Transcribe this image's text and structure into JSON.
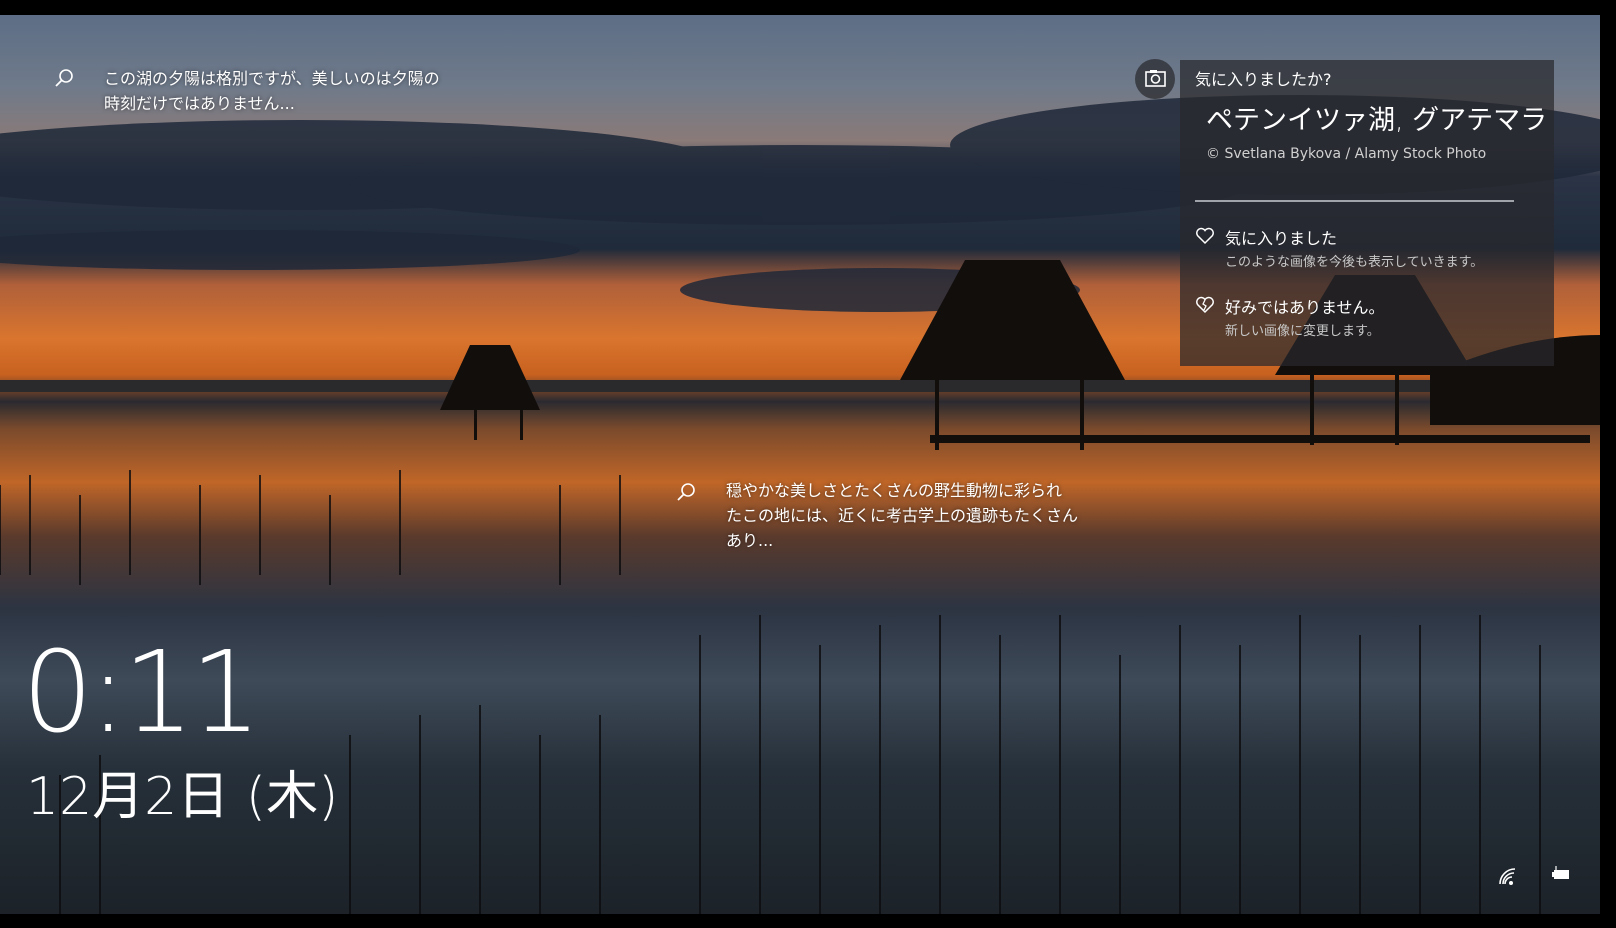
{
  "hotspots": [
    {
      "icon": "search-icon",
      "lines": [
        "この湖の夕陽は格別ですが、美しいのは夕陽の",
        "時刻だけではありません..."
      ]
    },
    {
      "icon": "search-icon",
      "lines": [
        "穏やかな美しさとたくさんの野生動物に彩られ",
        "たこの地には、近くに考古学上の遺跡もたくさん",
        "あり..."
      ]
    }
  ],
  "spotlight": {
    "camera_icon": "camera-icon",
    "question": "気に入りましたか?",
    "title": "ペテンイツァ湖, グアテマラ",
    "copyright": "© Svetlana Bykova / Alamy Stock Photo",
    "like": {
      "label": "気に入りました",
      "sub": "このような画像を今後も表示していきます。"
    },
    "dislike": {
      "label": "好みではありません。",
      "sub": "新しい画像に変更します。"
    }
  },
  "clock": {
    "time": "0:11",
    "date": "12月2日 (木)"
  },
  "tray": {
    "network_icon": "wifi-icon",
    "battery_icon": "battery-icon"
  }
}
